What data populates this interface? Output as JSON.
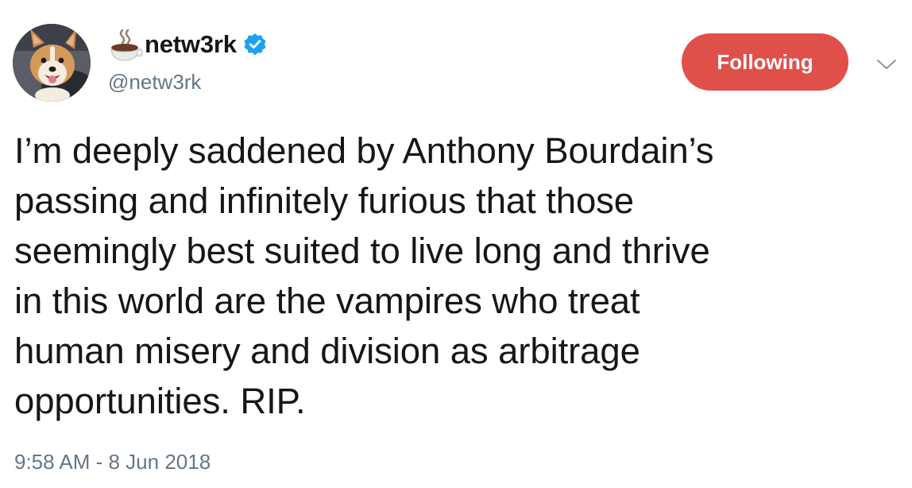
{
  "user": {
    "display_name": "netw3rk",
    "handle": "@netw3rk",
    "name_icon": "coffee-icon",
    "verified_icon": "verified-badge-icon",
    "avatar": "corgi-dog-avatar"
  },
  "actions": {
    "follow_label": "Following",
    "menu_icon": "chevron-down-icon"
  },
  "tweet": {
    "text": "I’m deeply saddened by Anthony Bourdain’s\npassing and infinitely furious that those\nseemingly best suited to live long and thrive\nin this world are the vampires who treat\nhuman misery and division as arbitrage\nopportunities. RIP.",
    "timestamp": "9:58 AM - 8 Jun 2018"
  },
  "colors": {
    "follow_button": "#e0504a",
    "verified": "#1da1f2",
    "secondary_text": "#657786",
    "primary_text": "#14171a"
  }
}
